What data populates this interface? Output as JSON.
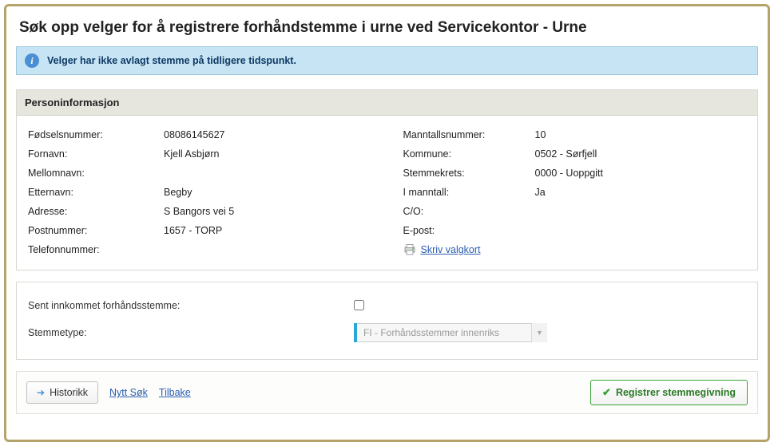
{
  "page_title": "Søk opp velger for å registrere forhåndstemme i urne ved Servicekontor - Urne",
  "info_message": "Velger har ikke avlagt stemme på tidligere tidspunkt.",
  "person_panel": {
    "heading": "Personinformasjon",
    "left": {
      "fodselsnummer_label": "Fødselsnummer:",
      "fodselsnummer_value": "08086145627",
      "fornavn_label": "Fornavn:",
      "fornavn_value": "Kjell Asbjørn",
      "mellomnavn_label": "Mellomnavn:",
      "mellomnavn_value": "",
      "etternavn_label": "Etternavn:",
      "etternavn_value": "Begby",
      "adresse_label": "Adresse:",
      "adresse_value": "S Bangors vei 5",
      "postnummer_label": "Postnummer:",
      "postnummer_value": "1657 - TORP",
      "telefon_label": "Telefonnummer:",
      "telefon_value": ""
    },
    "right": {
      "manntall_label": "Manntallsnummer:",
      "manntall_value": "10",
      "kommune_label": "Kommune:",
      "kommune_value": "0502 - Sørfjell",
      "stemmekrets_label": "Stemmekrets:",
      "stemmekrets_value": "0000 - Uoppgitt",
      "imanntall_label": "I manntall:",
      "imanntall_value": "Ja",
      "co_label": "C/O:",
      "co_value": "",
      "epost_label": "E-post:",
      "epost_value": "",
      "print_link": "Skriv valgkort"
    }
  },
  "options": {
    "sent_label": "Sent innkommet forhåndsstemme:",
    "sent_checked": false,
    "stemmetype_label": "Stemmetype:",
    "stemmetype_value": "FI - Forhåndsstemmer innenriks"
  },
  "footer": {
    "historikk": "Historikk",
    "nytt_sok": "Nytt Søk",
    "tilbake": "Tilbake",
    "register": "Registrer stemmegivning"
  }
}
